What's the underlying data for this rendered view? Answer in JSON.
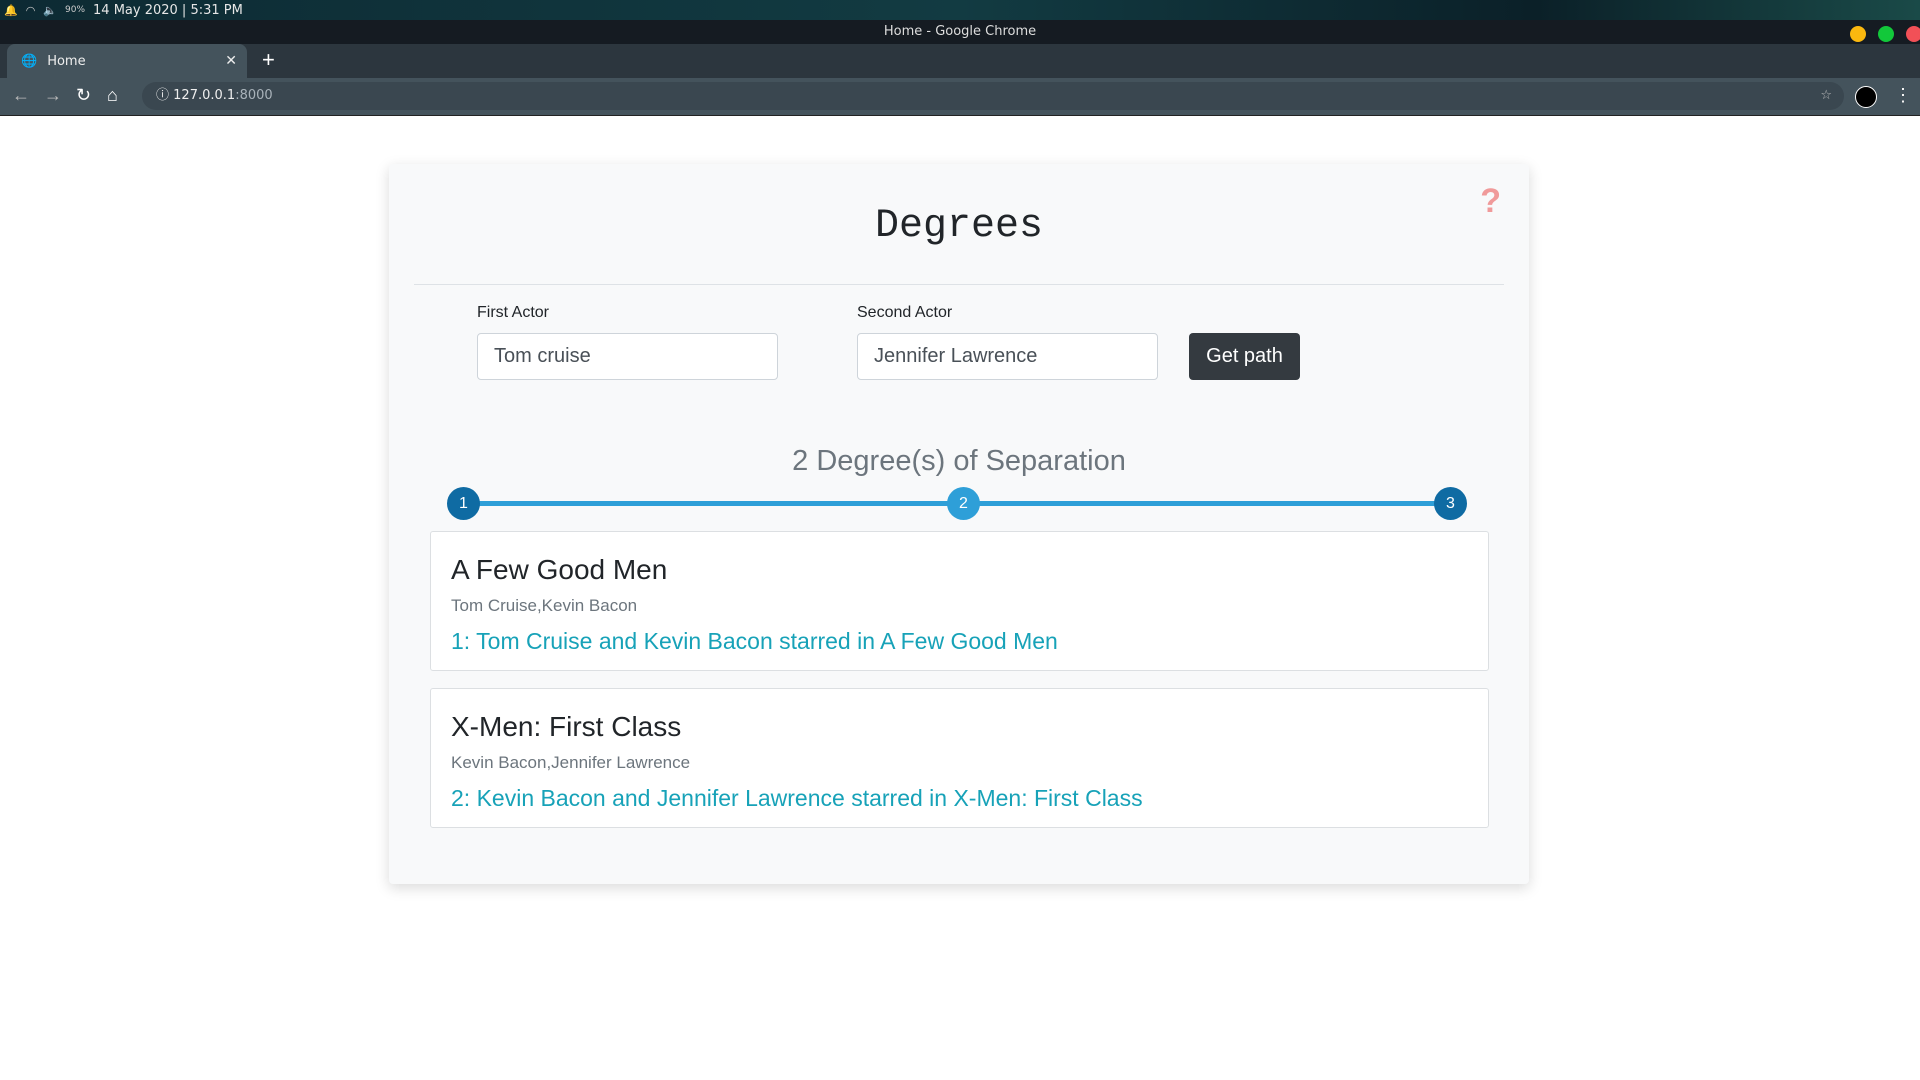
{
  "system": {
    "datetime": "14 May 2020 | 5:31 PM",
    "battery": "90%"
  },
  "window": {
    "title": "Home - Google Chrome",
    "colors": {
      "minimize": "#fbb80f",
      "maximize": "#12c83a",
      "close": "#f25057"
    }
  },
  "browser": {
    "tab_label": "Home",
    "url_host": "127.0.0.1",
    "url_port": ":8000"
  },
  "app": {
    "title": "Degrees",
    "help": "?",
    "first_actor": {
      "label": "First Actor",
      "value": "Tom cruise"
    },
    "second_actor": {
      "label": "Second Actor",
      "value": "Jennifer Lawrence"
    },
    "submit_label": "Get path",
    "separation": "2 Degree(s) of Separation",
    "steps": [
      "1",
      "2",
      "3"
    ],
    "results": [
      {
        "title": "A Few Good Men",
        "actors": "Tom Cruise,Kevin Bacon",
        "link": "1: Tom Cruise and Kevin Bacon starred in A Few Good Men"
      },
      {
        "title": "X-Men: First Class",
        "actors": "Kevin Bacon,Jennifer Lawrence",
        "link": "2: Kevin Bacon and Jennifer Lawrence starred in X-Men: First Class"
      }
    ]
  }
}
